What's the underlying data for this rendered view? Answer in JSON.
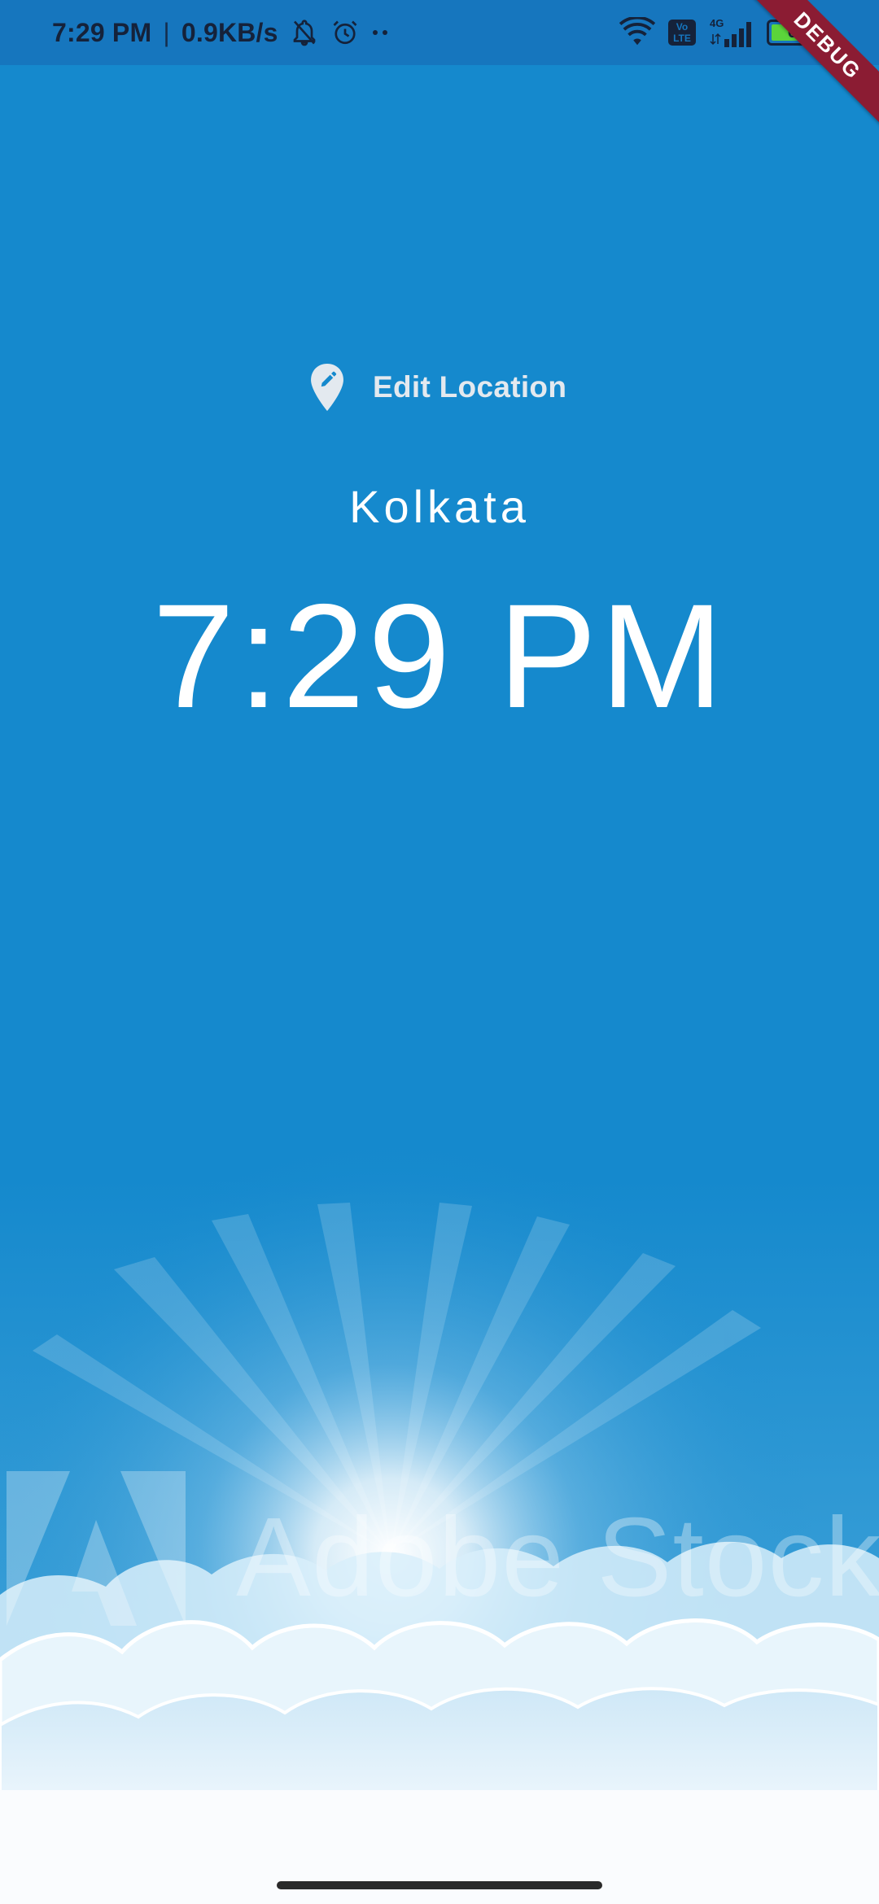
{
  "status_bar": {
    "time": "7:29 PM",
    "separator": "|",
    "net_speed": "0.9KB/s",
    "icons": [
      "notifications-off-icon",
      "alarm-icon",
      "more-dots-icon",
      "wifi-icon",
      "volte-icon",
      "signal-4g-icon",
      "battery-icon"
    ],
    "volte_text_top": "Vo",
    "volte_text_bottom": "LTE",
    "network_type": "4G",
    "battery_level": "67"
  },
  "debug_banner": {
    "label": "DEBUG",
    "color": "#8B1C33"
  },
  "main": {
    "edit_location_label": "Edit Location",
    "edit_location_icon": "location-edit-icon",
    "location": "Kolkata",
    "time": "7:29 PM"
  },
  "background": {
    "sky_color": "#1589CD",
    "cloud_color": "#FFFFFF",
    "watermark_text": "Adobe Stock"
  }
}
